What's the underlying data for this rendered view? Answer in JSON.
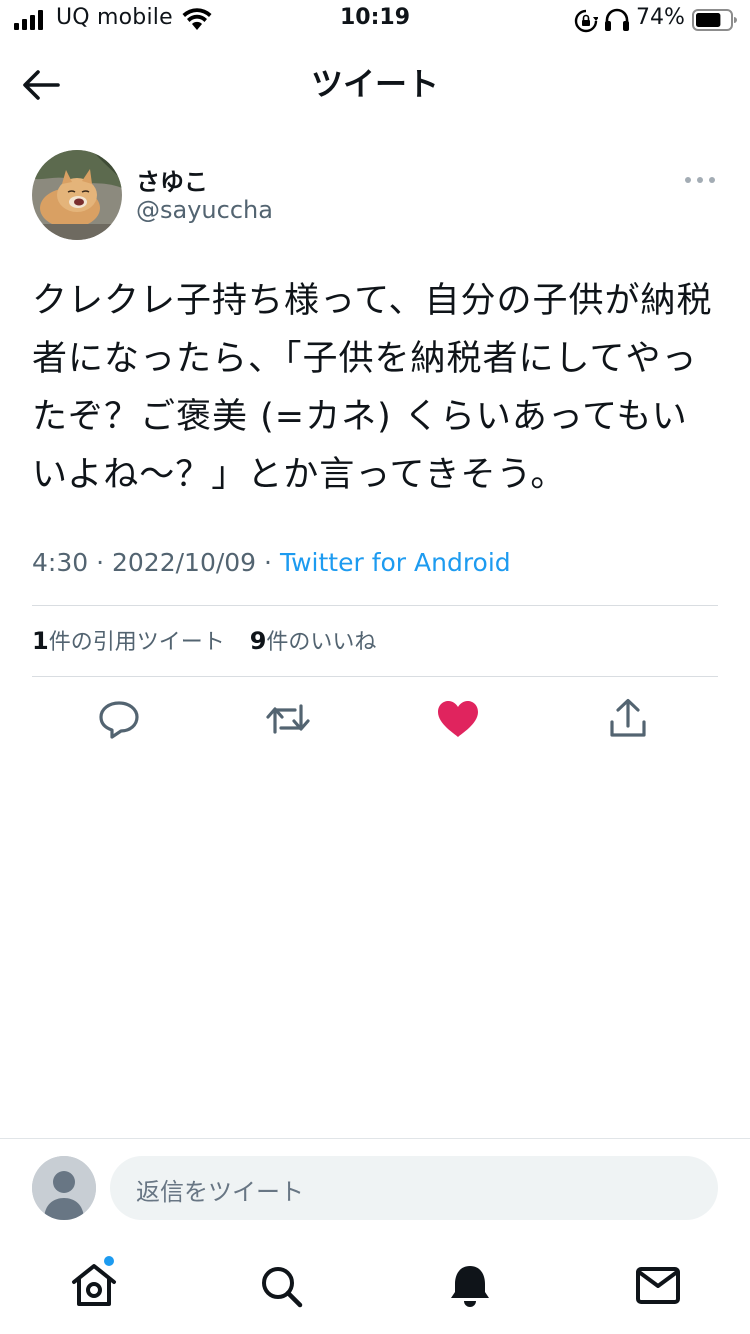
{
  "status_bar": {
    "carrier": "UQ mobile",
    "time": "10:19",
    "battery_percent": "74%",
    "battery_level": 0.74
  },
  "nav": {
    "title": "ツイート"
  },
  "tweet": {
    "display_name": "さゆこ",
    "username": "@sayuccha",
    "text": "クレクレ子持ち様って、自分の子供が納税者になったら、「子供を納税者にしてやったぞ？ご褒美 (=カネ) くらいあってもいいよね〜？」とか言ってきそう。",
    "time": "4:30",
    "date": "2022/10/09",
    "separator": "·",
    "source": "Twitter for Android",
    "quote_count": "1",
    "quote_label": "件の引用ツイート",
    "like_count": "9",
    "like_label": "件のいいね",
    "liked": true
  },
  "actions": {
    "reply_icon": "reply-icon",
    "retweet_icon": "retweet-icon",
    "like_icon": "heart-icon",
    "share_icon": "share-icon",
    "like_color": "#e0245e"
  },
  "reply": {
    "placeholder": "返信をツイート"
  },
  "tabs": [
    {
      "icon": "home-icon",
      "has_notification_dot": true
    },
    {
      "icon": "search-icon"
    },
    {
      "icon": "bell-icon"
    },
    {
      "icon": "mail-icon"
    }
  ],
  "colors": {
    "accent": "#1d9bf0",
    "text": "#0f1419",
    "secondary": "#536471"
  }
}
